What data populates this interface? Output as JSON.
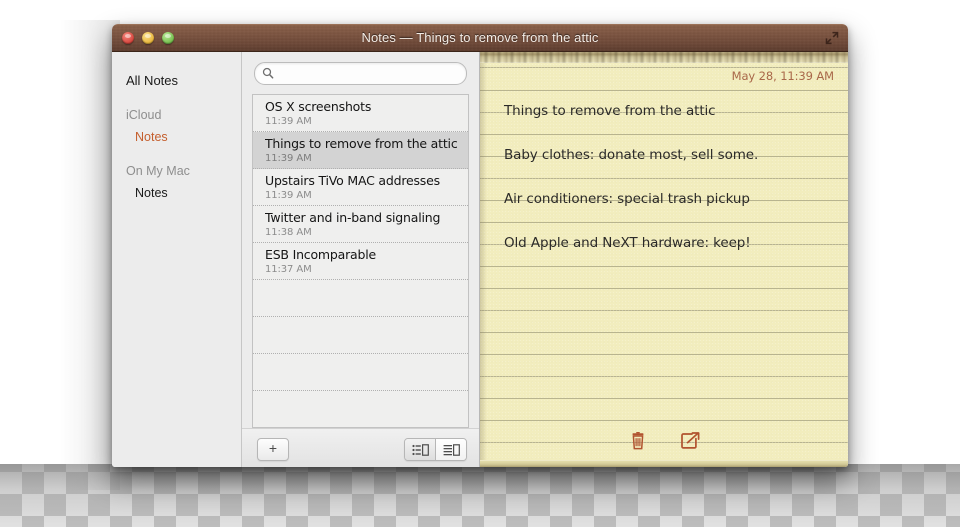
{
  "window": {
    "title": "Notes — Things to remove from the attic",
    "traffic_lights": [
      {
        "name": "close",
        "color": "#d6453c"
      },
      {
        "name": "minimize",
        "color": "#e8b53a"
      },
      {
        "name": "zoom",
        "color": "#74bf4c"
      }
    ],
    "fullscreen_icon": "fullscreen-icon"
  },
  "sidebar": {
    "all_notes_label": "All Notes",
    "groups": [
      {
        "header": "iCloud",
        "items": [
          {
            "label": "Notes",
            "selected": true
          }
        ]
      },
      {
        "header": "On My Mac",
        "items": [
          {
            "label": "Notes",
            "selected": false
          }
        ]
      }
    ]
  },
  "search": {
    "value": "",
    "placeholder": "",
    "icon": "search-icon"
  },
  "notes_list": {
    "items": [
      {
        "title": "OS X screenshots",
        "time": "11:39 AM",
        "selected": false
      },
      {
        "title": "Things to remove from the attic",
        "time": "11:39 AM",
        "selected": true
      },
      {
        "title": "Upstairs TiVo MAC addresses",
        "time": "11:39 AM",
        "selected": false
      },
      {
        "title": "Twitter and in-band signaling",
        "time": "11:38 AM",
        "selected": false
      },
      {
        "title": "ESB Incomparable",
        "time": "11:37 AM",
        "selected": false
      }
    ],
    "empty_rows": 4
  },
  "list_toolbar": {
    "add_label": "+",
    "view_modes": [
      {
        "name": "list-view-compact",
        "active": false
      },
      {
        "name": "list-view-detail",
        "active": true
      }
    ]
  },
  "note": {
    "date": "May 28, 11:39 AM",
    "lines": [
      "Things to remove from the attic",
      "Baby clothes: donate most, sell some.",
      "Air conditioners: special trash pickup",
      "Old Apple and NeXT hardware: keep!"
    ],
    "toolbar": [
      {
        "name": "delete-note-button",
        "icon": "trash-icon"
      },
      {
        "name": "share-note-button",
        "icon": "share-icon"
      }
    ]
  },
  "colors": {
    "titlebar_brown": "#7d5440",
    "paper_yellow": "#f2edbe",
    "accent_orange": "#c55f2e",
    "note_date_brown": "#a9684a",
    "icon_red_brown": "#b1532f",
    "selected_row_gray": "#d3d3d3"
  }
}
